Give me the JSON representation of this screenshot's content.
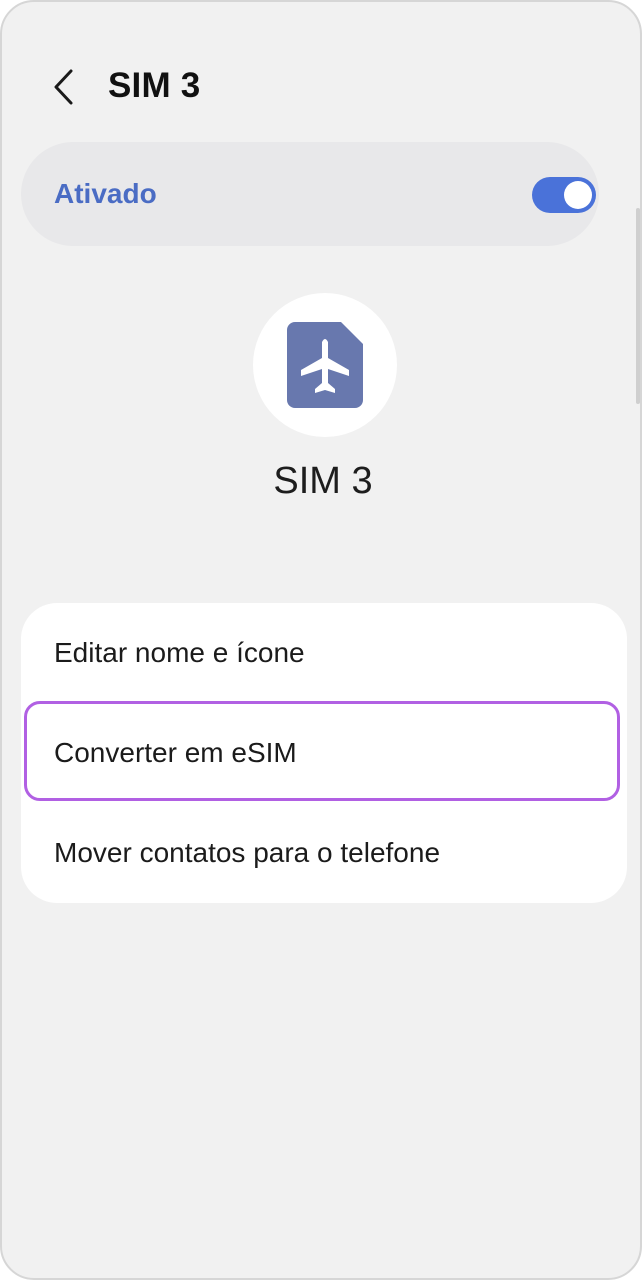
{
  "header": {
    "title": "SIM 3"
  },
  "toggle": {
    "label": "Ativado",
    "state": "on",
    "accent_color": "#4a72d9"
  },
  "sim": {
    "icon": "airplane-sim-icon",
    "icon_color": "#6878ae",
    "name": "SIM 3"
  },
  "menu": {
    "items": [
      {
        "label": "Editar nome e ícone"
      },
      {
        "label": "Converter em eSIM",
        "highlighted": true
      },
      {
        "label": "Mover contatos para o telefone"
      }
    ]
  },
  "highlight_color": "#b160e3"
}
